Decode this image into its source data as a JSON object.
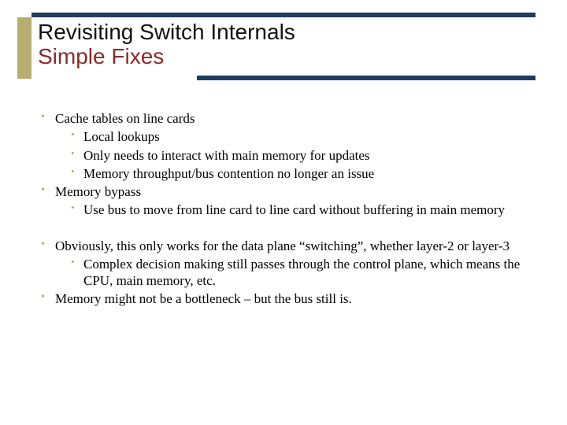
{
  "title": {
    "line1": "Revisiting Switch Internals",
    "line2": "Simple Fixes"
  },
  "section1": [
    {
      "text": "Cache tables on line cards",
      "sub": [
        "Local lookups",
        "Only needs to interact with main memory for updates",
        "Memory throughput/bus contention no longer an issue"
      ]
    },
    {
      "text": "Memory bypass",
      "sub": [
        "Use bus to move from line card to line card without buffering in main memory"
      ]
    }
  ],
  "section2": [
    {
      "text": "Obviously, this only works for the data plane “switching”, whether layer-2 or layer-3",
      "sub": [
        "Complex decision making still passes through the control plane, which means the CPU, main memory, etc."
      ]
    },
    {
      "text": "Memory might not be a bottleneck – but the bus still is.",
      "sub": []
    }
  ]
}
